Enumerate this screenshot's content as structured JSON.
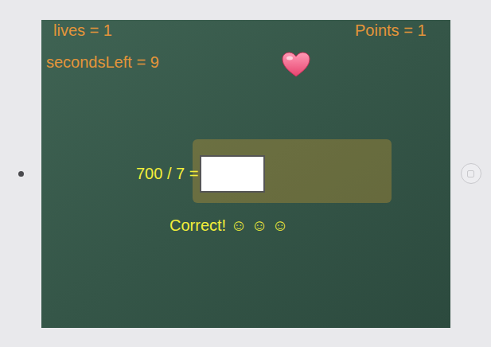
{
  "hud": {
    "lives": "lives = 1",
    "points": "Points = 1",
    "seconds": "secondsLeft = 9"
  },
  "question": {
    "text": "700 / 7 =",
    "answer": ""
  },
  "feedback": "Correct! ☺ ☺ ☺"
}
